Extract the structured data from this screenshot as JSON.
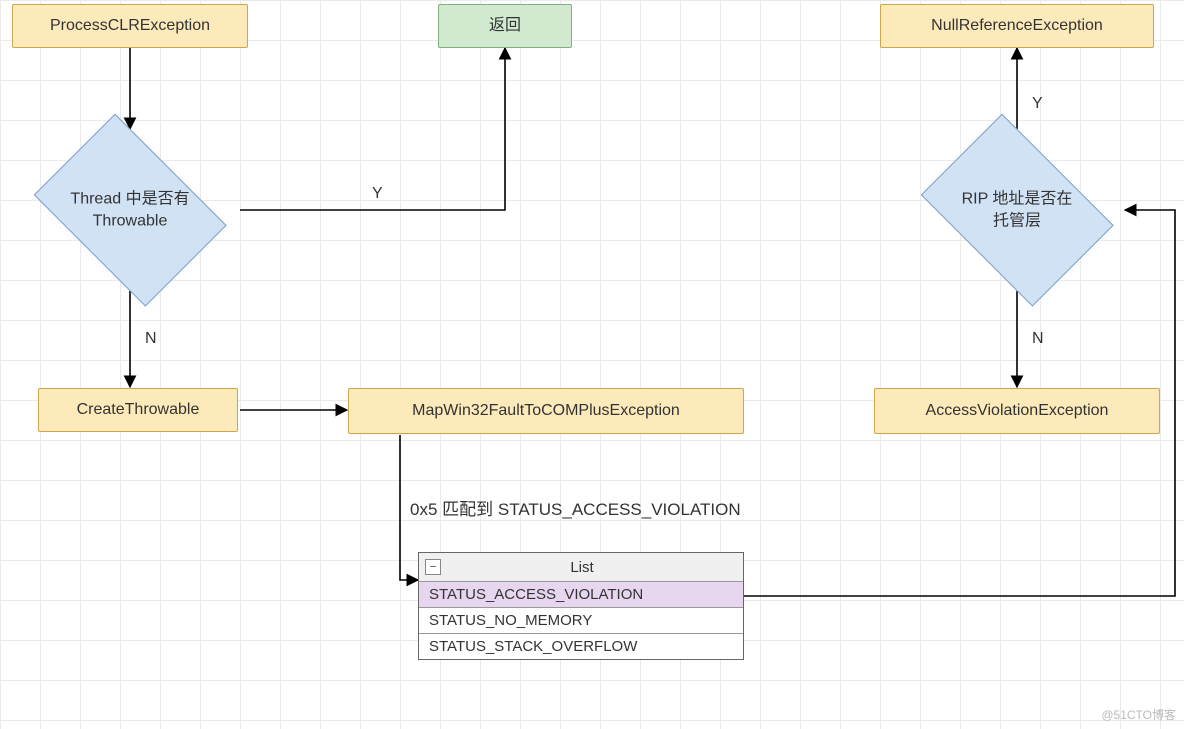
{
  "nodes": {
    "process_clr": {
      "label": "ProcessCLRException"
    },
    "return": {
      "label": "返回"
    },
    "nullref": {
      "label": "NullReferenceException"
    },
    "thread_throw": {
      "label": "Thread 中是否有\nThrowable"
    },
    "rip_managed": {
      "label": "RIP 地址是否在\n托管层"
    },
    "create_throw": {
      "label": "CreateThrowable"
    },
    "mapwin32": {
      "label": "MapWin32FaultToCOMPlusException"
    },
    "av_exc": {
      "label": "AccessViolationException"
    }
  },
  "edges": {
    "thread_yes": "Y",
    "thread_no": "N",
    "rip_yes": "Y",
    "rip_no": "N",
    "map_note": "0x5 匹配到 STATUS_ACCESS_VIOLATION"
  },
  "list": {
    "title": "List",
    "items": [
      "STATUS_ACCESS_VIOLATION",
      "STATUS_NO_MEMORY",
      "STATUS_STACK_OVERFLOW"
    ],
    "selected_index": 0
  },
  "watermark": "@51CTO博客"
}
